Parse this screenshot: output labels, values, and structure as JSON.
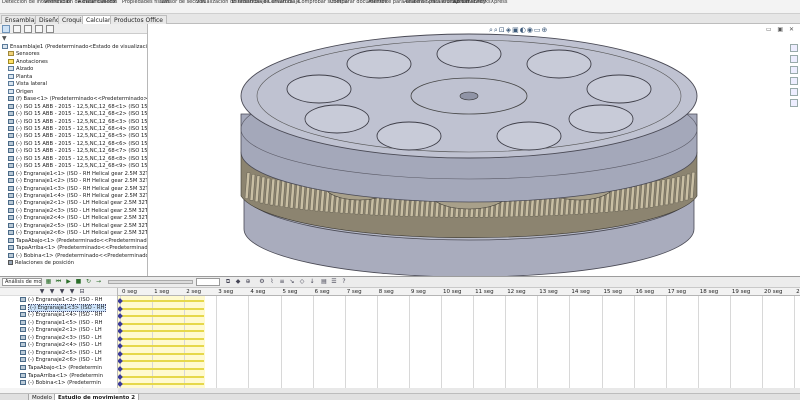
{
  "ribbon": {
    "items": [
      {
        "label": "Detección de interferencias"
      },
      {
        "label": "Verificación de distancia"
      },
      {
        "label": "Alinear taladros"
      },
      {
        "label": "Medir"
      },
      {
        "label": "Propiedades físicas"
      },
      {
        "label": "Sensor de sección"
      },
      {
        "label": "Visualización de ensamblaje"
      },
      {
        "label": "Estadísticas de ensamblaje"
      },
      {
        "label": "Curvatura"
      },
      {
        "label": "Comprobar simetría"
      },
      {
        "label": "Comparar documentos"
      },
      {
        "label": "Asistente para análisis SimulationXpress"
      },
      {
        "label": "Asistente para análisis DriveWorksXpress"
      },
      {
        "label": "Sustainability"
      }
    ]
  },
  "command_tabs": [
    "Ensamblaje",
    "Diseño",
    "Croquis",
    "Calcular",
    "Productos Office"
  ],
  "command_tab_active": "Calcular",
  "feature_tree": {
    "filter_icon": "filter-icon",
    "items": [
      {
        "label": "Ensamblaje1  (Predeterminado<Estado de visualización-1>)",
        "icon": "assembly-icon",
        "indent": 0
      },
      {
        "label": "Sensores",
        "icon": "folder-icon",
        "indent": 1
      },
      {
        "label": "Anotaciones",
        "icon": "annotation-icon",
        "indent": 1
      },
      {
        "label": "Alzado",
        "icon": "plane-icon",
        "indent": 1
      },
      {
        "label": "Planta",
        "icon": "plane-icon",
        "indent": 1
      },
      {
        "label": "Vista lateral",
        "icon": "plane-icon",
        "indent": 1
      },
      {
        "label": "Origen",
        "icon": "origin-icon",
        "indent": 1
      },
      {
        "label": "(f) Base<1> (Predeterminado<<Predeterminado>_Estad",
        "icon": "part-icon",
        "indent": 1
      },
      {
        "label": "(-) ISO 15 ABB - 2015 - 12,5,NC,12_68<1> (ISO 15 ABB - 2",
        "icon": "part-icon",
        "indent": 1
      },
      {
        "label": "(-) ISO 15 ABB - 2015 - 12,5,NC,12_68<2> (ISO 15 ABB - 2",
        "icon": "part-icon",
        "indent": 1
      },
      {
        "label": "(-) ISO 15 ABB - 2015 - 12,5,NC,12_68<3> (ISO 15 ABB - 2",
        "icon": "part-icon",
        "indent": 1
      },
      {
        "label": "(-) ISO 15 ABB - 2015 - 12,5,NC,12_68<4> (ISO 15 ABB - 2",
        "icon": "part-icon",
        "indent": 1
      },
      {
        "label": "(-) ISO 15 ABB - 2015 - 12,5,NC,12_68<5> (ISO 15 ABB - 2",
        "icon": "part-icon",
        "indent": 1
      },
      {
        "label": "(-) ISO 15 ABB - 2015 - 12,5,NC,12_68<6> (ISO 15 ABB - 2",
        "icon": "part-icon",
        "indent": 1
      },
      {
        "label": "(-) ISO 15 ABB - 2015 - 12,5,NC,12_68<7> (ISO 15 ABB - 2",
        "icon": "part-icon",
        "indent": 1
      },
      {
        "label": "(-) ISO 15 ABB - 2015 - 12,5,NC,12_68<8> (ISO 15 ABB - 2",
        "icon": "part-icon",
        "indent": 1
      },
      {
        "label": "(-) ISO 15 ABB - 2015 - 12,5,NC,12_68<9> (ISO 15 ABB - 2",
        "icon": "part-icon",
        "indent": 1
      },
      {
        "label": "(-) Engranaje1<1> (ISO - RH Helical gear 2.5M 32T 30HA",
        "icon": "part-icon",
        "indent": 1
      },
      {
        "label": "(-) Engranaje1<2> (ISO - RH Helical gear 2.5M 32T 30HA",
        "icon": "part-icon",
        "indent": 1
      },
      {
        "label": "(-) Engranaje1<3> (ISO - RH Helical gear 2.5M 32T 30HA",
        "icon": "part-icon",
        "indent": 1
      },
      {
        "label": "(-) Engranaje1<4> (ISO - RH Helical gear 2.5M 32T 30HA",
        "icon": "part-icon",
        "indent": 1
      },
      {
        "label": "(-) Engranaje2<1> (ISO - LH Helical gear 2.5M 32T 30HA",
        "icon": "part-icon",
        "indent": 1
      },
      {
        "label": "(-) Engranaje2<3> (ISO - LH Helical gear 2.5M 32T 30HA",
        "icon": "part-icon",
        "indent": 1
      },
      {
        "label": "(-) Engranaje2<4> (ISO - LH Helical gear 2.5M 32T 30HA",
        "icon": "part-icon",
        "indent": 1
      },
      {
        "label": "(-) Engranaje2<5> (ISO - LH Helical gear 2.5M 32T 30HA",
        "icon": "part-icon",
        "indent": 1
      },
      {
        "label": "(-) Engranaje2<6> (ISO - LH Helical gear 2.5M 32T 30HA",
        "icon": "part-icon",
        "indent": 1
      },
      {
        "label": "TapaAbajo<1> (Predeterminado<<Predeterminado>_Esta",
        "icon": "part-icon",
        "indent": 1
      },
      {
        "label": "TapaArriba<1> (Predeterminado<<Predeterminado>_Esta",
        "icon": "part-icon",
        "indent": 1
      },
      {
        "label": "(-) Bobina<1> (Predeterminado<<Predeterminado>_Estad",
        "icon": "part-icon",
        "indent": 1
      },
      {
        "label": "Relaciones de posición",
        "icon": "mates-icon",
        "indent": 1
      }
    ]
  },
  "motion_study": {
    "study_type": "Análisis de movimiento",
    "speed": "",
    "time_labels": [
      "0 seg",
      "1 seg",
      "2 seg",
      "3 seg",
      "4 seg",
      "5 seg",
      "6 seg",
      "7 seg",
      "8 seg",
      "9 seg",
      "10 seg",
      "11 seg",
      "12 seg",
      "13 seg",
      "14 seg",
      "15 seg",
      "16 seg",
      "17 seg",
      "18 seg",
      "19 seg",
      "20 seg",
      "21 seg"
    ],
    "rows": [
      {
        "label": "(-) Engranaje1<2> (ISO - RH"
      },
      {
        "label": "(-) Engranaje1<3> (ISO - RH",
        "selected": true
      },
      {
        "label": "(-) Engranaje1<4> (ISO - RH"
      },
      {
        "label": "(-) Engranaje1<5> (ISO - RH"
      },
      {
        "label": "(-) Engranaje2<1> (ISO - LH"
      },
      {
        "label": "(-) Engranaje2<3> (ISO - LH"
      },
      {
        "label": "(-) Engranaje2<4> (ISO - LH"
      },
      {
        "label": "(-) Engranaje2<5> (ISO - LH"
      },
      {
        "label": "(-) Engranaje2<6> (ISO - LH"
      },
      {
        "label": "TapaAbajo<1> (Predetermin"
      },
      {
        "label": "TapaArriba<1> (Predetermin"
      },
      {
        "label": "(-) Bobina<1> (Predetermin"
      },
      {
        "label": "Relaciones de posición (41 re"
      }
    ],
    "bottom_tabs": [
      "Modelo",
      "Estudio de movimiento 2"
    ],
    "bottom_tab_active": "Estudio de movimiento 2"
  },
  "colors": {
    "accent": "#3a3a9a",
    "timeline_highlight": "#fff6a8",
    "bar_yellow": "#e6d84a",
    "bar_orange": "#d4a040",
    "model_gray": "#b9bccb"
  }
}
